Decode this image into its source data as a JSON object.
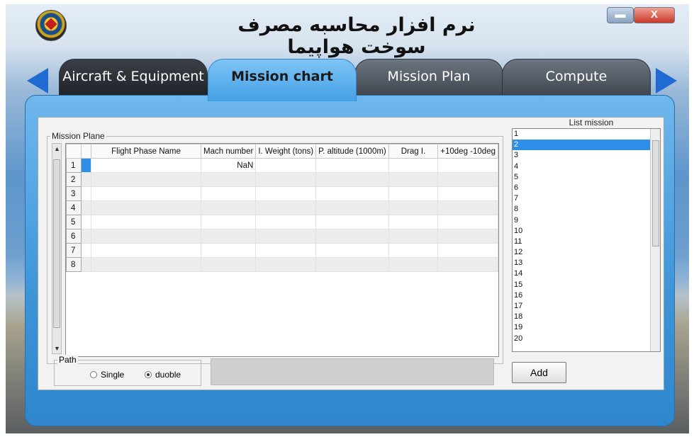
{
  "window": {
    "title": "نرم افزار محاسبه مصرف سوخت هواپیما",
    "minimize_glyph": "▬",
    "close_glyph": "X"
  },
  "tabs": [
    {
      "label": "Aircraft & Equipment"
    },
    {
      "label": "Mission chart"
    },
    {
      "label": "Mission Plan"
    },
    {
      "label": "Compute"
    }
  ],
  "mission_plane": {
    "legend": "Mission Plane",
    "columns": [
      "Flight Phase Name",
      "Mach number",
      "I. Weight (tons)",
      "P. altitude (1000m)",
      "Drag I.",
      "+10deg -10deg"
    ],
    "rows": [
      {
        "num": "1",
        "cells": [
          "",
          "NaN",
          "",
          "",
          "",
          ""
        ]
      },
      {
        "num": "2",
        "cells": [
          "",
          "",
          "",
          "",
          "",
          ""
        ]
      },
      {
        "num": "3",
        "cells": [
          "",
          "",
          "",
          "",
          "",
          ""
        ]
      },
      {
        "num": "4",
        "cells": [
          "",
          "",
          "",
          "",
          "",
          ""
        ]
      },
      {
        "num": "5",
        "cells": [
          "",
          "",
          "",
          "",
          "",
          ""
        ]
      },
      {
        "num": "6",
        "cells": [
          "",
          "",
          "",
          "",
          "",
          ""
        ]
      },
      {
        "num": "7",
        "cells": [
          "",
          "",
          "",
          "",
          "",
          ""
        ]
      },
      {
        "num": "8",
        "cells": [
          "",
          "",
          "",
          "",
          "",
          ""
        ]
      }
    ]
  },
  "list_mission": {
    "title": "List mission",
    "items": [
      "1",
      "2",
      "3",
      "4",
      "5",
      "6",
      "7",
      "8",
      "9",
      "10",
      "11",
      "12",
      "13",
      "14",
      "15",
      "16",
      "17",
      "18",
      "19",
      "20"
    ],
    "selected": "2"
  },
  "path": {
    "legend": "Path",
    "options": [
      {
        "label": "Single",
        "checked": false
      },
      {
        "label": "duoble",
        "checked": true
      }
    ]
  },
  "add_button": "Add",
  "colors": {
    "accent": "#2f8fe8",
    "panel": "#4aa3e4",
    "tab_dark": "#3f4650"
  }
}
